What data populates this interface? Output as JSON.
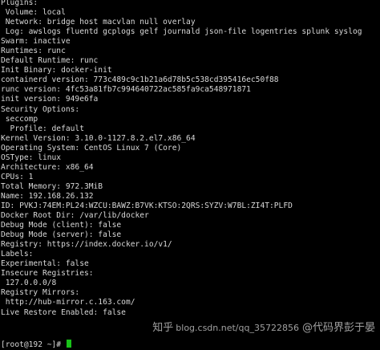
{
  "terminal": {
    "background": "#000000",
    "foreground": "#d8d8d8",
    "cursor_color": "#19c219",
    "lines": [
      "Plugins:",
      " Volume: local",
      " Network: bridge host macvlan null overlay",
      " Log: awslogs fluentd gcplogs gelf journald json-file logentries splunk syslog",
      "Swarm: inactive",
      "Runtimes: runc",
      "Default Runtime: runc",
      "Init Binary: docker-init",
      "containerd version: 773c489c9c1b21a6d78b5c538cd395416ec50f88",
      "runc version: 4fc53a81fb7c994640722ac585fa9ca548971871",
      "init version: 949e6fa",
      "Security Options:",
      " seccomp",
      "  Profile: default",
      "Kernel Version: 3.10.0-1127.8.2.el7.x86_64",
      "Operating System: CentOS Linux 7 (Core)",
      "OSType: linux",
      "Architecture: x86_64",
      "CPUs: 1",
      "Total Memory: 972.3MiB",
      "Name: 192.168.26.132",
      "ID: PVKJ:74EM:PL24:WZCU:BAWZ:B7VK:KTSO:2QRS:SYZV:W7BL:ZI4T:PLFD",
      "Docker Root Dir: /var/lib/docker",
      "Debug Mode (client): false",
      "Debug Mode (server): false",
      "Registry: https://index.docker.io/v1/",
      "Labels:",
      "Experimental: false",
      "Insecure Registries:",
      " 127.0.0.0/8",
      "Registry Mirrors:",
      " http://hub-mirror.c.163.com/",
      "Live Restore Enabled: false",
      ""
    ],
    "prompt": "[root@192 ~]# "
  },
  "watermark": {
    "brand": "知乎",
    "site": "@代码界彭于晏",
    "user": "blog.csdn.net/qq_35722856"
  }
}
